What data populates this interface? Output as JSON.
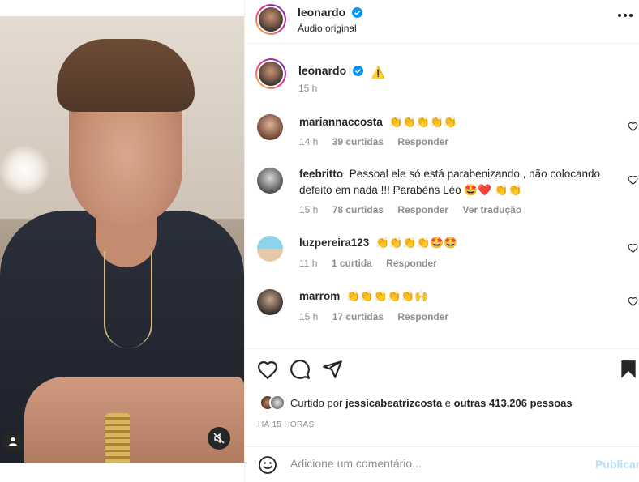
{
  "post": {
    "author": "leonardo",
    "audio": "Áudio original",
    "caption_warning": "⚠️",
    "caption_time": "15 h"
  },
  "comments": [
    {
      "user": "mariannaccosta",
      "text": "👏👏👏👏👏",
      "time": "14 h",
      "likes": "39 curtidas",
      "reply": "Responder",
      "translate": ""
    },
    {
      "user": "feebritto",
      "text": "Pessoal ele só está parabenizando , não colocando defeito em nada !!! Parabéns Léo 🤩❤️ 👏👏",
      "time": "15 h",
      "likes": "78 curtidas",
      "reply": "Responder",
      "translate": "Ver tradução"
    },
    {
      "user": "luzpereira123",
      "text": "👏👏👏👏🤩🤩",
      "time": "11 h",
      "likes": "1 curtida",
      "reply": "Responder",
      "translate": ""
    },
    {
      "user": "marrom",
      "text": "👏👏👏👏👏🙌",
      "time": "15 h",
      "likes": "17 curtidas",
      "reply": "Responder",
      "translate": ""
    }
  ],
  "likes": {
    "prefix": "Curtido por",
    "user": "jessicabeatrizcosta",
    "middle": "e",
    "others": "outras 413,206 pessoas"
  },
  "posted_ago": "HÁ 15 HORAS",
  "add_comment": {
    "placeholder": "Adicione um comentário...",
    "publish_label": "Publicar"
  },
  "colors": {
    "link_disabled": "#b2dffc",
    "verified": "#0095f6",
    "muted": "#8e8e8e"
  }
}
